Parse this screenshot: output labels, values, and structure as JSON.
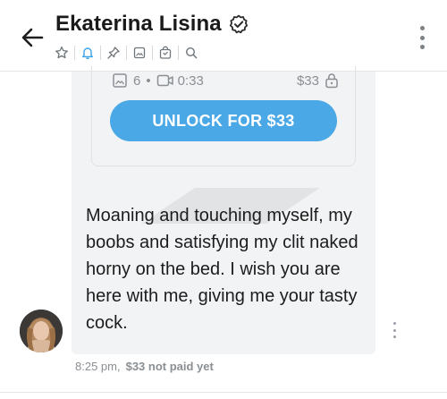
{
  "header": {
    "title": "Ekaterina Lisina",
    "verified_icon": "verified-badge-icon",
    "icons": [
      "star-icon",
      "bell-icon",
      "pin-icon",
      "image-icon",
      "locked-media-icon",
      "search-icon"
    ],
    "accent_color": "#3ba4e8"
  },
  "locked_post": {
    "photo_count": "6",
    "separator": "•",
    "video_duration": "0:33",
    "price": "$33",
    "unlock_label": "UNLOCK FOR $33",
    "button_color": "#4aa8e6"
  },
  "message": {
    "text": "Moaning and touching myself, my boobs and satisfying my clit naked horny on the bed. I wish you are here with me, giving me your tasty cock.",
    "time": "8:25 pm,",
    "paid_status": "$33 not paid yet"
  }
}
